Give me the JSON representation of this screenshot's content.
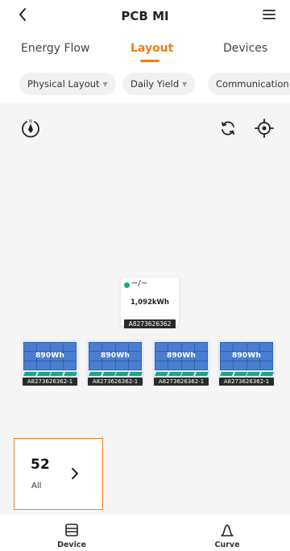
{
  "header": {
    "title": "PCB MI",
    "back_icon": "chevron-left-icon",
    "menu_icon": "hamburger-menu-icon"
  },
  "tabs": [
    {
      "label": "Energy Flow"
    },
    {
      "label": "Layout",
      "active": true
    },
    {
      "label": "Devices"
    }
  ],
  "filters": [
    {
      "label": "Physical Layout"
    },
    {
      "label": "Daily Yield"
    },
    {
      "label": "Communication"
    }
  ],
  "canvas_controls": {
    "compass_icon": "compass-icon",
    "refresh_icon": "refresh-icon",
    "locate_icon": "locate-icon"
  },
  "gateway": {
    "status_icon": "~/~",
    "energy": "1,092kWh",
    "serial": "A8273626362"
  },
  "panels": [
    {
      "watt": "890Wh",
      "serial": "A8273626362-1"
    },
    {
      "watt": "890Wh",
      "serial": "A8273626362-1"
    },
    {
      "watt": "890Wh",
      "serial": "A8273626362-1"
    },
    {
      "watt": "890Wh",
      "serial": "A8273626362-1"
    }
  ],
  "summary": {
    "count": "52",
    "label": "All"
  },
  "bottom_nav": [
    {
      "label": "Device",
      "icon": "device-icon"
    },
    {
      "label": "Curve",
      "icon": "curve-icon"
    }
  ],
  "colors": {
    "accent": "#ef7d1a",
    "panel_blue": "#2f63b7",
    "status_green": "#1aa88a"
  }
}
